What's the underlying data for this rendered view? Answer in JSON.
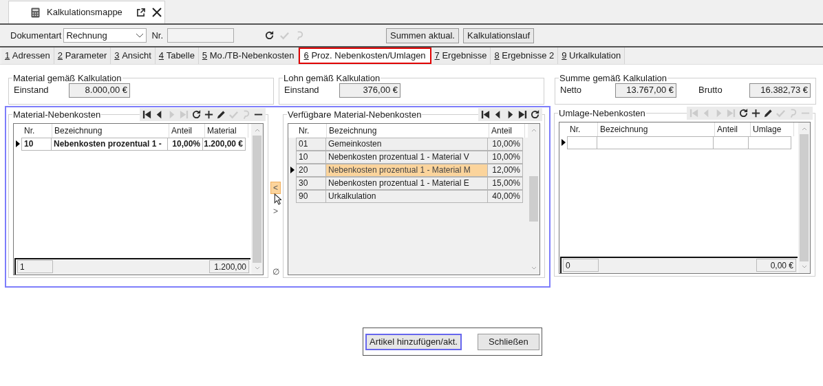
{
  "window_tab": {
    "title": "Kalkulationsmappe"
  },
  "toolbar": {
    "document_type_label": "Dokumentart",
    "document_type": "Rechnung",
    "number_label": "Nr.",
    "actions": [
      {
        "kind": "refresh",
        "disabled": false
      },
      {
        "kind": "check",
        "disabled": true
      },
      {
        "kind": "undo",
        "disabled": true
      }
    ],
    "buttons": [
      "Summen aktual.",
      "Kalkulationslauf"
    ]
  },
  "tabs": [
    {
      "number": "1",
      "label": "Adressen",
      "selected": false
    },
    {
      "number": "2",
      "label": "Parameter",
      "selected": false
    },
    {
      "number": "3",
      "label": "Ansicht",
      "selected": false
    },
    {
      "number": "4",
      "label": "Tabelle",
      "selected": false
    },
    {
      "number": "5",
      "label": "Mo./TB-Nebenkosten",
      "selected": false
    },
    {
      "number": "6",
      "label": "Proz. Nebenkosten/Umlagen",
      "selected": true
    },
    {
      "number": "7",
      "label": "Ergebnisse",
      "selected": false
    },
    {
      "number": "8",
      "label": "Ergebnisse 2",
      "selected": false
    },
    {
      "number": "9",
      "label": "Urkalkulation",
      "selected": false
    }
  ],
  "summary_groups": [
    {
      "title": "Material gemäß Kalkulation",
      "fields": [
        {
          "label": "Einstand",
          "value": "8.000,00 €"
        }
      ]
    },
    {
      "title": "Lohn gemäß Kalkulation",
      "fields": [
        {
          "label": "Einstand",
          "value": "376,00 €"
        }
      ]
    },
    {
      "title": "Summe gemäß Kalkulation",
      "fields": [
        {
          "label": "Netto",
          "value": "13.767,00 €"
        },
        {
          "label": "Brutto",
          "value": "16.382,73 €"
        }
      ]
    }
  ],
  "grids": [
    {
      "title": "Material-Nebenkosten",
      "read_only": false,
      "toolbar": [
        {
          "kind": "first",
          "disabled": false
        },
        {
          "kind": "prev",
          "disabled": false
        },
        {
          "kind": "next",
          "disabled": true
        },
        {
          "kind": "last",
          "disabled": true
        },
        {
          "kind": "refresh",
          "disabled": false
        },
        {
          "kind": "add",
          "disabled": false
        },
        {
          "kind": "edit",
          "disabled": false
        },
        {
          "kind": "check",
          "disabled": true
        },
        {
          "kind": "undo",
          "disabled": true
        },
        {
          "kind": "minus",
          "disabled": false
        }
      ],
      "columns": [
        "Nr.",
        "Bezeichnung",
        "Anteil",
        "Material"
      ],
      "rows": [
        {
          "selected": true,
          "bold": true,
          "highlighted": false,
          "cells": [
            "10",
            "Nebenkosten prozentual 1 -",
            "10,00%",
            "1.200,00 €"
          ]
        }
      ],
      "footer": {
        "count": "1",
        "total": "1.200,00"
      }
    },
    {
      "title": "Verfügbare Material-Nebenkosten",
      "read_only": true,
      "toolbar": [
        {
          "kind": "first",
          "disabled": false
        },
        {
          "kind": "prev",
          "disabled": false
        },
        {
          "kind": "next",
          "disabled": false
        },
        {
          "kind": "last",
          "disabled": false
        },
        {
          "kind": "refresh",
          "disabled": false
        }
      ],
      "columns": [
        "Nr.",
        "Bezeichnung",
        "Anteil"
      ],
      "rows": [
        {
          "selected": false,
          "bold": false,
          "highlighted": false,
          "cells": [
            "01",
            "Gemeinkosten",
            "10,00%"
          ]
        },
        {
          "selected": false,
          "bold": false,
          "highlighted": false,
          "cells": [
            "10",
            "Nebenkosten prozentual 1 - Material V",
            "10,00%"
          ]
        },
        {
          "selected": true,
          "bold": false,
          "highlighted": true,
          "cells": [
            "20",
            "Nebenkosten prozentual 1 - Material M",
            "12,00%"
          ]
        },
        {
          "selected": false,
          "bold": false,
          "highlighted": false,
          "cells": [
            "30",
            "Nebenkosten prozentual 1 - Material E",
            "15,00%"
          ]
        },
        {
          "selected": false,
          "bold": false,
          "highlighted": false,
          "cells": [
            "90",
            "Urkalkulation",
            "40,00%"
          ]
        }
      ]
    },
    {
      "title": "Umlage-Nebenkosten",
      "read_only": false,
      "toolbar": [
        {
          "kind": "first",
          "disabled": true
        },
        {
          "kind": "prev",
          "disabled": true
        },
        {
          "kind": "next",
          "disabled": true
        },
        {
          "kind": "last",
          "disabled": true
        },
        {
          "kind": "refresh",
          "disabled": false
        },
        {
          "kind": "add",
          "disabled": false
        },
        {
          "kind": "edit",
          "disabled": false
        },
        {
          "kind": "check",
          "disabled": true
        },
        {
          "kind": "undo",
          "disabled": true
        },
        {
          "kind": "minus",
          "disabled": true
        }
      ],
      "columns": [
        "Nr.",
        "Bezeichnung",
        "Anteil",
        "Umlage"
      ],
      "rows": [
        {
          "selected": true,
          "bold": false,
          "highlighted": false
        }
      ],
      "footer": {
        "count": "0",
        "total": "0,00 €"
      }
    }
  ],
  "transfer_buttons": [
    {
      "label": "<",
      "hovered": true
    },
    {
      "label": ">",
      "hovered": false
    }
  ],
  "clear_symbol": "∅",
  "dialog_buttons": [
    {
      "label": "Artikel hinzufügen/akt.",
      "focused": true
    },
    {
      "label": "Schließen",
      "focused": false
    }
  ]
}
